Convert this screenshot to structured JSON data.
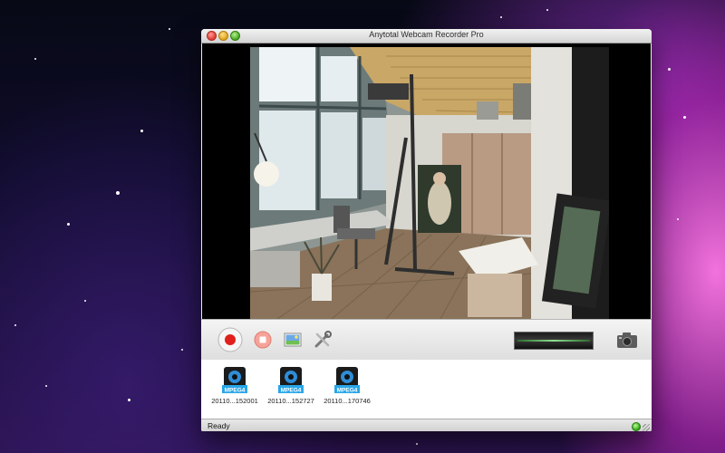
{
  "window": {
    "title": "Anytotal Webcam Recorder Pro"
  },
  "toolbar": {
    "record_icon": "record-icon",
    "stop_icon": "stop-icon",
    "snapshot_icon": "image-icon",
    "settings_icon": "tools-icon",
    "camera_icon": "camera-icon"
  },
  "files": [
    {
      "name": "20110...152001",
      "icon": "mpeg4-file-icon"
    },
    {
      "name": "20110...152727",
      "icon": "mpeg4-file-icon"
    },
    {
      "name": "20110...170746",
      "icon": "mpeg4-file-icon"
    }
  ],
  "file_badge": "MPEG4",
  "status": {
    "text": "Ready",
    "led_color": "#2ea312"
  },
  "colors": {
    "record_red": "#e0201c",
    "stop_red": "#f2685c"
  }
}
